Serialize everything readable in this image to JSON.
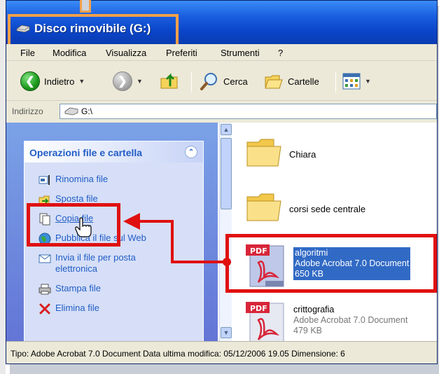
{
  "window": {
    "title": "Disco rimovibile (G:)"
  },
  "menu": [
    "File",
    "Modifica",
    "Visualizza",
    "Preferiti",
    "Strumenti",
    "?"
  ],
  "toolbar": {
    "back_label": "Indietro",
    "search_label": "Cerca",
    "folders_label": "Cartelle"
  },
  "address": {
    "label": "Indirizzo",
    "value": "G:\\"
  },
  "taskpane": {
    "title": "Operazioni file e cartella",
    "items": [
      {
        "label": "Rinomina file",
        "icon": "rename-icon"
      },
      {
        "label": "Sposta file",
        "icon": "move-icon"
      },
      {
        "label": "Copia file",
        "icon": "copy-icon"
      },
      {
        "label": "Pubblica il file sul Web",
        "icon": "globe-icon"
      },
      {
        "label": "Invia il file per posta elettronica",
        "icon": "email-icon"
      },
      {
        "label": "Stampa file",
        "icon": "print-icon"
      },
      {
        "label": "Elimina file",
        "icon": "delete-icon"
      }
    ]
  },
  "files": [
    {
      "name": "Chiara",
      "type": "folder"
    },
    {
      "name": "corsi sede centrale",
      "type": "folder"
    },
    {
      "name": "algoritmi",
      "kind": "Adobe Acrobat 7.0 Document",
      "size": "650 KB",
      "type": "pdf",
      "selected": true
    },
    {
      "name": "crittografia",
      "kind": "Adobe Acrobat 7.0 Document",
      "size": "479 KB",
      "type": "pdf",
      "selected": false
    }
  ],
  "status": "Tipo: Adobe Acrobat 7.0 Document Data ultima modifica: 05/12/2006 19.05 Dimensione: 6",
  "colors": {
    "title_gradient": "#0a45c8",
    "highlight_orange": "#f0a04b",
    "annotation_red": "#e01010",
    "selection_blue": "#316ac5",
    "link_blue": "#215dc6"
  }
}
